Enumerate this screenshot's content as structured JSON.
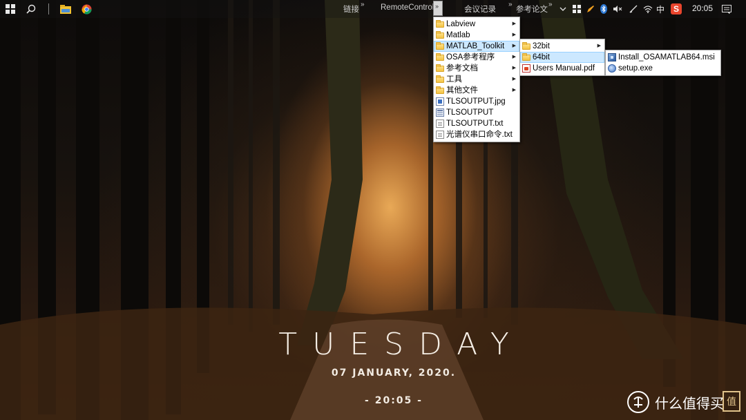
{
  "taskbar": {
    "toolbar_links": [
      {
        "label": "链接"
      },
      {
        "label": "RemoteControl"
      },
      {
        "label": "会议记录"
      },
      {
        "label": "参考论文"
      }
    ],
    "tray": {
      "ime": "中",
      "clock": "20:05"
    }
  },
  "menu_root": {
    "items": [
      {
        "label": "Labview",
        "type": "folder",
        "submenu": true
      },
      {
        "label": "Matlab",
        "type": "folder",
        "submenu": true
      },
      {
        "label": "MATLAB_Toolkit",
        "type": "folder",
        "submenu": true,
        "highlighted": true
      },
      {
        "label": "OSA参考程序",
        "type": "folder",
        "submenu": true
      },
      {
        "label": "参考文档",
        "type": "folder",
        "submenu": true
      },
      {
        "label": "工具",
        "type": "folder",
        "submenu": true
      },
      {
        "label": "其他文件",
        "type": "folder",
        "submenu": true
      },
      {
        "label": "TLSOUTPUT.jpg",
        "type": "image"
      },
      {
        "label": "TLSOUTPUT",
        "type": "generic"
      },
      {
        "label": "TLSOUTPUT.txt",
        "type": "text"
      },
      {
        "label": "光谱仪串口命令.txt",
        "type": "text"
      }
    ]
  },
  "menu_toolkit": {
    "items": [
      {
        "label": "32bit",
        "type": "folder",
        "submenu": true
      },
      {
        "label": "64bit",
        "type": "folder",
        "highlighted": true
      },
      {
        "label": "Users Manual.pdf",
        "type": "pdf"
      }
    ]
  },
  "menu_64bit": {
    "items": [
      {
        "label": "Install_OSAMATLAB64.msi",
        "type": "msi"
      },
      {
        "label": "setup.exe",
        "type": "exe"
      }
    ]
  },
  "desktop_widget": {
    "day": "TUESDAY",
    "date": "07 JANUARY, 2020.",
    "time": "- 20:05 -"
  },
  "watermark": {
    "text": "什么值得买",
    "seal": "值"
  },
  "colors": {
    "menu_highlight": "#cce8ff",
    "menu_highlight_border": "#99d1ff",
    "clock_text": "#f6efe6"
  }
}
